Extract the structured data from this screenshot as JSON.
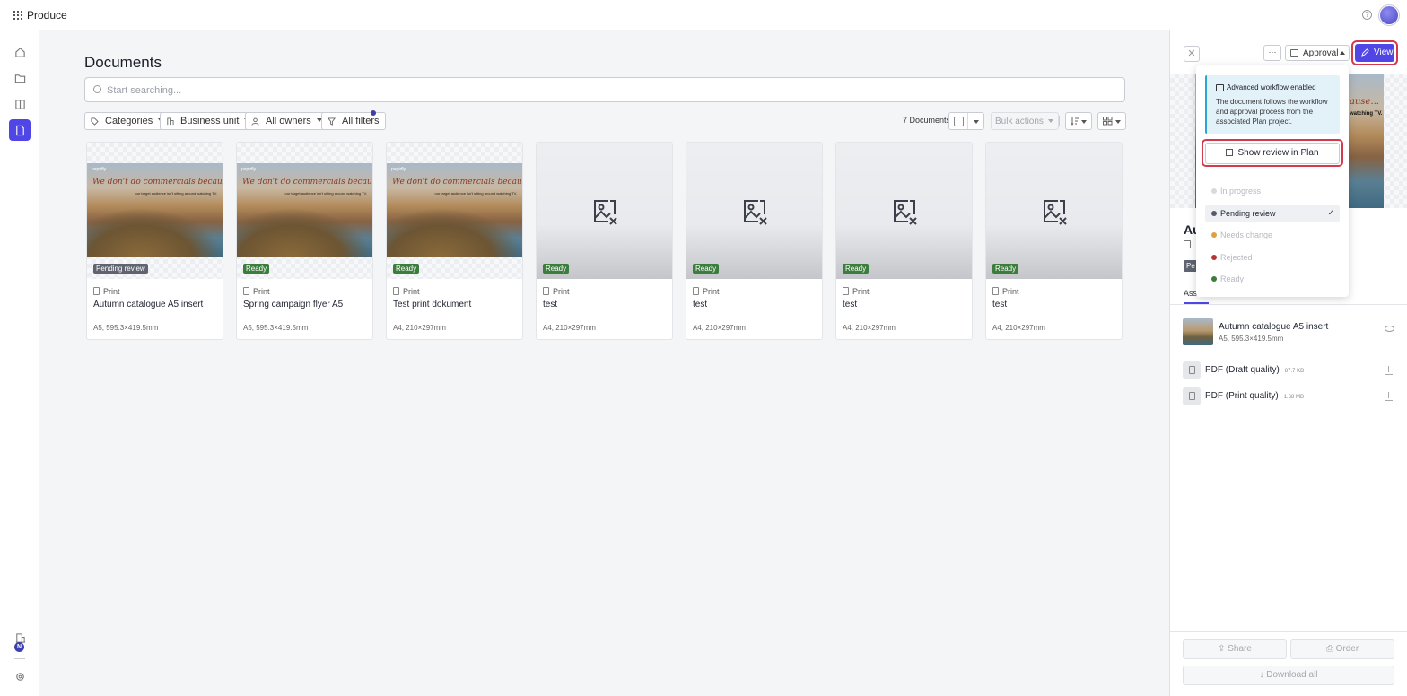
{
  "app": {
    "name": "Produce"
  },
  "page": {
    "title": "Documents"
  },
  "search": {
    "placeholder": "Start searching..."
  },
  "filters": {
    "categories": "Categories",
    "business_unit": "Business unit",
    "owners": "All owners",
    "all_filters": "All filters"
  },
  "toolbar": {
    "doc_count": "7 Documents",
    "bulk_actions": "Bulk actions"
  },
  "documents": [
    {
      "name": "Autumn catalogue A5 insert",
      "type": "Print",
      "size": "A5, 595.3×419.5mm",
      "status": "Pending review",
      "has_image": true
    },
    {
      "name": "Spring campaign flyer A5",
      "type": "Print",
      "size": "A5, 595.3×419.5mm",
      "status": "Ready",
      "has_image": true
    },
    {
      "name": "Test print dokument",
      "type": "Print",
      "size": "A4, 210×297mm",
      "status": "Ready",
      "has_image": true
    },
    {
      "name": "test",
      "type": "Print",
      "size": "A4, 210×297mm",
      "status": "Ready",
      "has_image": false
    },
    {
      "name": "test",
      "type": "Print",
      "size": "A4, 210×297mm",
      "status": "Ready",
      "has_image": false
    },
    {
      "name": "test",
      "type": "Print",
      "size": "A4, 210×297mm",
      "status": "Ready",
      "has_image": false
    },
    {
      "name": "test",
      "type": "Print",
      "size": "A4, 210×297mm",
      "status": "Ready",
      "has_image": false
    }
  ],
  "thumbnail_text": {
    "brand": "papirfly",
    "headline": "We don't do commercials because...",
    "sub": "our target audience isn't sitting around watching TV.",
    "panel_headline": "ause...",
    "panel_sub": "watching TV."
  },
  "panel": {
    "approval_label": "Approval",
    "view_label": "View",
    "title_partial": "Au",
    "status_partial": "Pe",
    "tab_partial": "Ass",
    "assets": [
      {
        "name": "Autumn catalogue A5 insert",
        "size": "A5, 595.3×419.5mm"
      }
    ],
    "files": [
      {
        "name": "PDF (Draft quality)",
        "size": "87.7 KB"
      },
      {
        "name": "PDF (Print quality)",
        "size": "1.68 MB"
      }
    ],
    "share_label": "Share",
    "order_label": "Order",
    "download_all_label": "Download all"
  },
  "workflow_dropdown": {
    "info_title": "Advanced workflow enabled",
    "info_desc": "The document follows the workflow and approval process from the associated Plan project.",
    "show_review_label": "Show review in Plan",
    "statuses": [
      {
        "label": "In progress",
        "color": "#d8dadf",
        "selected": false,
        "enabled": false
      },
      {
        "label": "Pending review",
        "color": "#555a66",
        "selected": true,
        "enabled": true
      },
      {
        "label": "Needs change",
        "color": "#e0a040",
        "selected": false,
        "enabled": false
      },
      {
        "label": "Rejected",
        "color": "#b83434",
        "selected": false,
        "enabled": false
      },
      {
        "label": "Ready",
        "color": "#3b7d3c",
        "selected": false,
        "enabled": false
      }
    ]
  },
  "nav": {
    "notification_badge": "N"
  },
  "colors": {
    "accent": "#4f46e5",
    "ready": "#3b7d3c",
    "pending": "#5f6470",
    "highlight": "#d43a4e"
  }
}
